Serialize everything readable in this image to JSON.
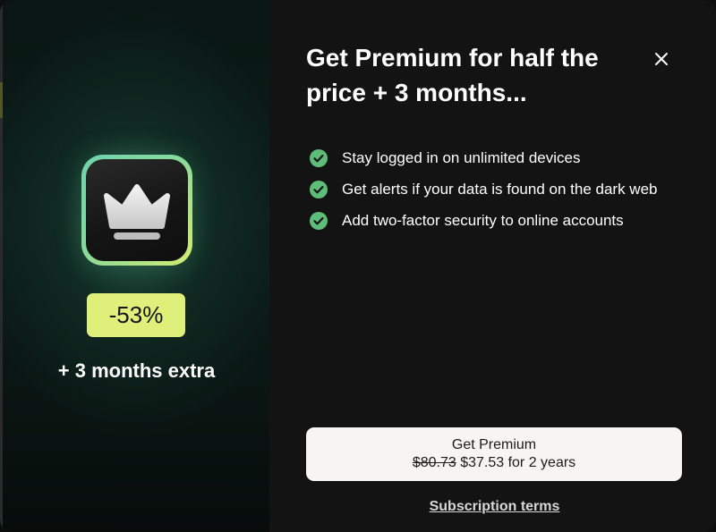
{
  "promo": {
    "discount": "-53%",
    "extra": "+ 3 months extra",
    "icon": "crown-icon",
    "badge_color": "#dff07a"
  },
  "dialog": {
    "title": "Get Premium for half the price + 3 months...",
    "close_icon": "close-icon"
  },
  "features": [
    {
      "icon": "check-circle-icon",
      "label": "Stay logged in on unlimited devices"
    },
    {
      "icon": "check-circle-icon",
      "label": "Get alerts if your data is found on the dark web"
    },
    {
      "icon": "check-circle-icon",
      "label": "Add two-factor security to online accounts"
    }
  ],
  "cta": {
    "label": "Get Premium",
    "old_price": "$80.73",
    "new_price": "$37.53 for 2 years"
  },
  "terms_link": "Subscription terms",
  "colors": {
    "accent_green": "#5fbd7a",
    "badge": "#dff07a",
    "background": "#131313"
  }
}
